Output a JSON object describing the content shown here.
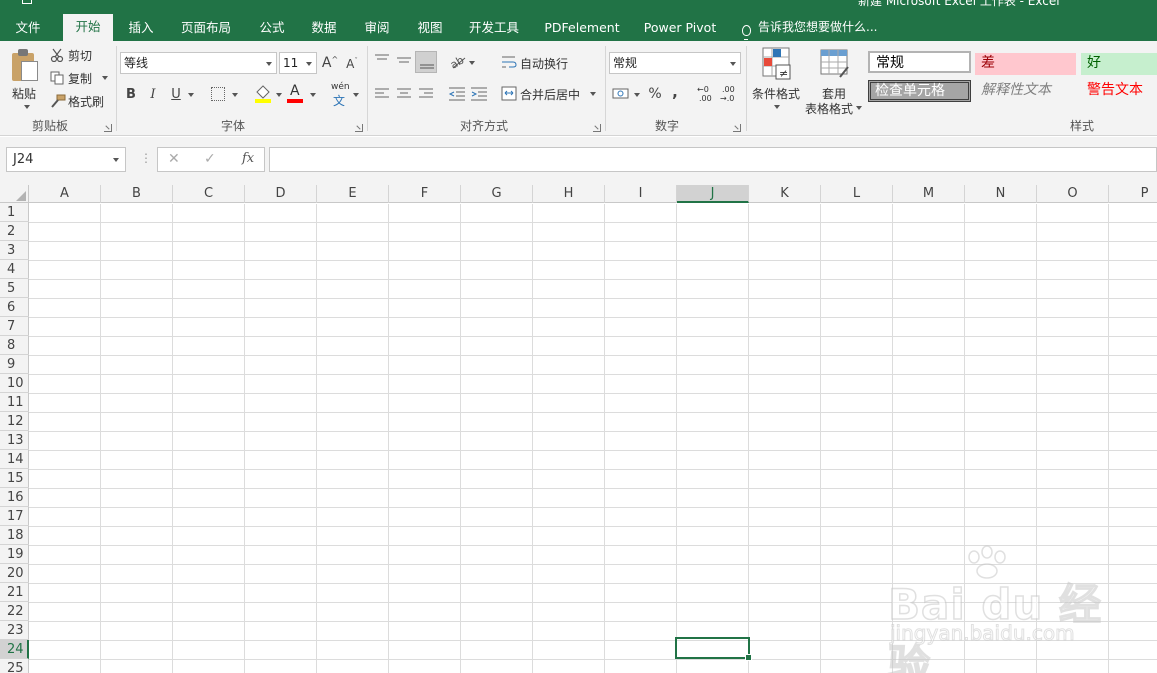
{
  "window": {
    "title": "新建 Microsoft Excel 工作表 - Excel"
  },
  "tabs": [
    {
      "label": "文件",
      "active": false
    },
    {
      "label": "开始",
      "active": true
    },
    {
      "label": "插入",
      "active": false
    },
    {
      "label": "页面布局",
      "active": false
    },
    {
      "label": "公式",
      "active": false
    },
    {
      "label": "数据",
      "active": false
    },
    {
      "label": "审阅",
      "active": false
    },
    {
      "label": "视图",
      "active": false
    },
    {
      "label": "开发工具",
      "active": false
    },
    {
      "label": "PDFelement",
      "active": false
    },
    {
      "label": "Power Pivot",
      "active": false
    }
  ],
  "tell_me": "告诉我您想要做什么...",
  "ribbon": {
    "clipboard": {
      "paste": "粘贴",
      "cut": "剪切",
      "copy": "复制",
      "format_painter": "格式刷",
      "group": "剪贴板"
    },
    "font": {
      "name": "等线",
      "size": "11",
      "bold": "B",
      "italic": "I",
      "underline": "U",
      "grow": "A",
      "shrink": "A",
      "phonetic_top": "wén",
      "phonetic_bottom": "文",
      "font_color_glyph": "A",
      "group": "字体"
    },
    "alignment": {
      "wrap": "自动换行",
      "merge": "合并后居中",
      "group": "对齐方式"
    },
    "number": {
      "format": "常规",
      "percent": "%",
      "comma": ",",
      "inc_top": "←0",
      "inc_bottom": ".00",
      "dec_top": ".00",
      "dec_bottom": "→.0",
      "group": "数字"
    },
    "styles": {
      "conditional": "条件格式",
      "table_top": "套用",
      "table_bottom": "表格格式",
      "normal": "常规",
      "bad": "差",
      "good": "好",
      "check": "检查单元格",
      "explanatory": "解释性文本",
      "warning": "警告文本",
      "group": "样式",
      "colors": {
        "bad_bg": "#ffc7ce",
        "bad_fg": "#9c0006",
        "good_bg": "#c6efce",
        "good_fg": "#006100",
        "check_bg": "#a5a5a5",
        "warning_fg": "#ff0000"
      }
    }
  },
  "formula_bar": {
    "name_box": "J24",
    "cancel": "✕",
    "enter": "✓",
    "fx": "fx",
    "value": ""
  },
  "sheet": {
    "columns": [
      "A",
      "B",
      "C",
      "D",
      "E",
      "F",
      "G",
      "H",
      "I",
      "J",
      "K",
      "L",
      "M",
      "N",
      "O",
      "P"
    ],
    "rows": [
      "1",
      "2",
      "3",
      "4",
      "5",
      "6",
      "7",
      "8",
      "9",
      "10",
      "11",
      "12",
      "13",
      "14",
      "15",
      "16",
      "17",
      "18",
      "19",
      "20",
      "21",
      "22",
      "23",
      "24",
      "25"
    ],
    "selected_column": "J",
    "selected_row": "24",
    "accent": "#217346"
  },
  "watermark": {
    "brand": "Bai du 经验",
    "url": "jingyan.baidu.com"
  }
}
